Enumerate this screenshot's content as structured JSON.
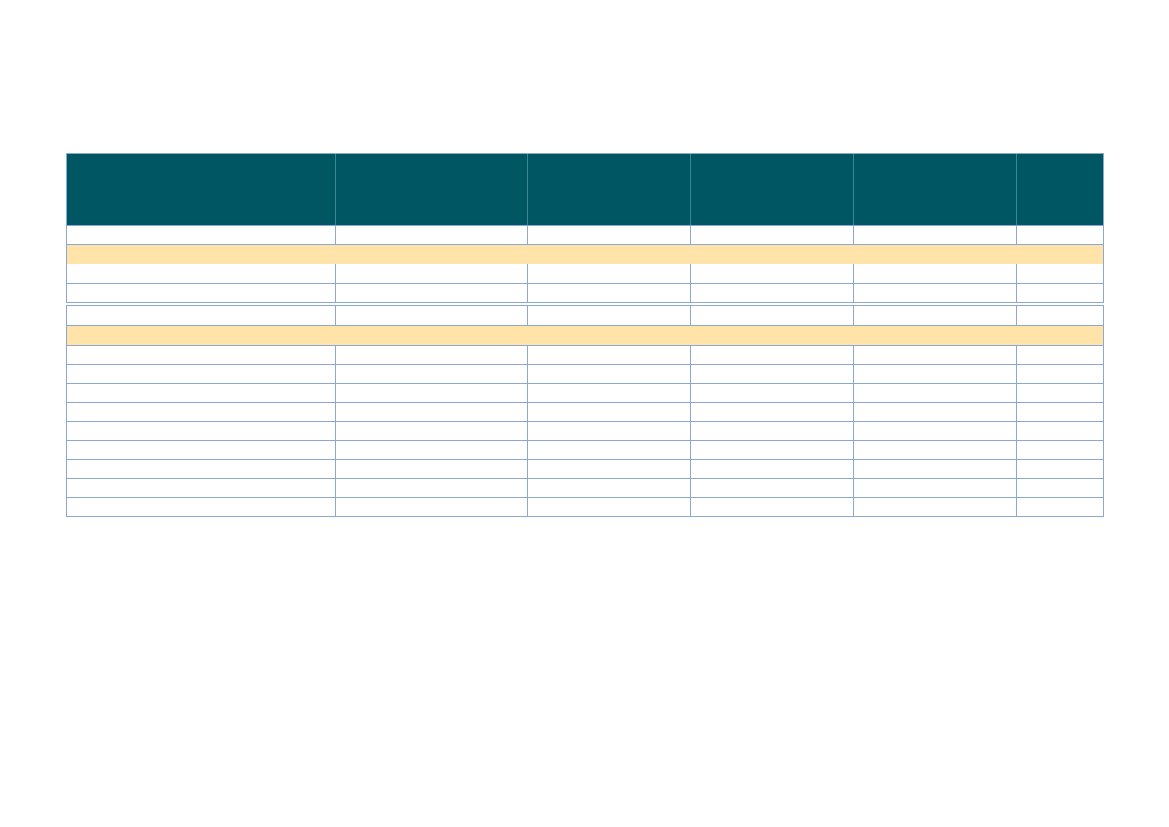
{
  "table": {
    "columns": [
      "",
      "",
      "",
      "",
      "",
      ""
    ],
    "block1": {
      "top_row": [
        "",
        "",
        "",
        "",
        "",
        ""
      ],
      "section_label": "",
      "rows": [
        [
          "",
          "",
          "",
          "",
          "",
          ""
        ],
        [
          "",
          "",
          "",
          "",
          "",
          ""
        ]
      ]
    },
    "block2": {
      "top_row": [
        "",
        "",
        "",
        "",
        "",
        ""
      ],
      "section_label": "",
      "rows": [
        [
          "",
          "",
          "",
          "",
          "",
          ""
        ],
        [
          "",
          "",
          "",
          "",
          "",
          ""
        ],
        [
          "",
          "",
          "",
          "",
          "",
          ""
        ],
        [
          "",
          "",
          "",
          "",
          "",
          ""
        ],
        [
          "",
          "",
          "",
          "",
          "",
          ""
        ],
        [
          "",
          "",
          "",
          "",
          "",
          ""
        ],
        [
          "",
          "",
          "",
          "",
          "",
          ""
        ],
        [
          "",
          "",
          "",
          "",
          "",
          ""
        ],
        [
          "",
          "",
          "",
          "",
          "",
          ""
        ]
      ]
    },
    "colors": {
      "header_bg": "#005763",
      "section_bg": "#ffe3a8",
      "grid_line": "#8aa8d2"
    }
  }
}
